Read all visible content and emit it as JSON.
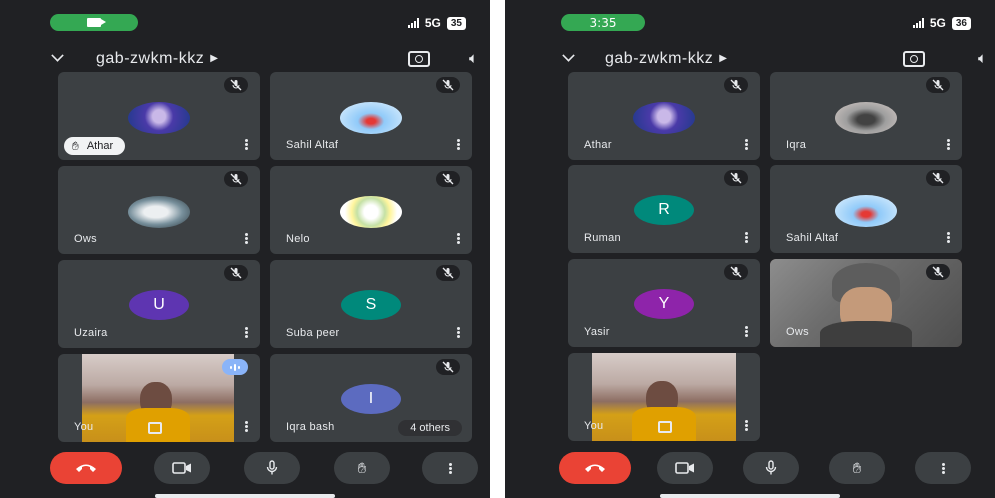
{
  "screens": [
    {
      "status": {
        "time": "",
        "network": "5G",
        "battery": "35"
      },
      "meeting_code": "gab-zwkm-kkz",
      "tiles": [
        {
          "name": "Athar",
          "kind": "photo",
          "hand_raised": true
        },
        {
          "name": "Sahil Altaf",
          "kind": "photo"
        },
        {
          "name": "Ows",
          "kind": "photo"
        },
        {
          "name": "Nelo",
          "kind": "photo"
        },
        {
          "name": "Uzaira",
          "kind": "letter",
          "letter": "U",
          "color": "#5e35b1"
        },
        {
          "name": "Suba peer",
          "kind": "letter",
          "letter": "S",
          "color": "#00897b"
        },
        {
          "name": "You",
          "kind": "self"
        },
        {
          "name": "Iqra bash",
          "kind": "letter",
          "letter": "I",
          "color": "#5c6bc0",
          "others_label": "4 others"
        }
      ]
    },
    {
      "status": {
        "time": "3:35",
        "network": "5G",
        "battery": "36"
      },
      "meeting_code": "gab-zwkm-kkz",
      "tiles": [
        {
          "name": "Athar",
          "kind": "photo"
        },
        {
          "name": "Iqra",
          "kind": "photo"
        },
        {
          "name": "Ruman",
          "kind": "letter",
          "letter": "R",
          "color": "#00897b"
        },
        {
          "name": "Sahil Altaf",
          "kind": "photo"
        },
        {
          "name": "Yasir",
          "kind": "letter",
          "letter": "Y",
          "color": "#8e24aa"
        },
        {
          "name": "Ows",
          "kind": "video"
        },
        {
          "name": "You",
          "kind": "self"
        }
      ]
    }
  ],
  "colors": {
    "background": "#202124",
    "tile": "#3c4043",
    "end_call": "#ea4335",
    "call_pill": "#34a853",
    "audio_badge": "#8ab4f8"
  },
  "icons": [
    "video-call-icon",
    "chevron-down-icon",
    "flip-camera-icon",
    "speaker-icon",
    "mic-off-icon",
    "more-vert-icon",
    "raise-hand-icon",
    "end-call-icon",
    "camera-icon",
    "mic-icon"
  ]
}
